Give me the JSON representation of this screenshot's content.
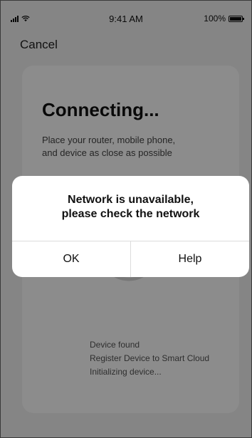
{
  "status_bar": {
    "time": "9:41 AM",
    "battery": "100%"
  },
  "nav": {
    "cancel_label": "Cancel"
  },
  "card": {
    "title": "Connecting...",
    "description_line1": "Place your router, mobile phone,",
    "description_line2": "and device as close as possible",
    "steps": [
      "Device found",
      "Register Device to Smart Cloud",
      "Initializing device..."
    ]
  },
  "alert": {
    "message_line1": "Network is unavailable,",
    "message_line2": "please check the network",
    "ok_label": "OK",
    "help_label": "Help"
  },
  "colors": {
    "overlay": "#000000",
    "progress_accent": "#3aa86b",
    "background": "#f2f2f2"
  },
  "icons": {
    "signal": "cellular-signal-icon",
    "wifi": "wifi-icon",
    "battery": "battery-icon"
  }
}
